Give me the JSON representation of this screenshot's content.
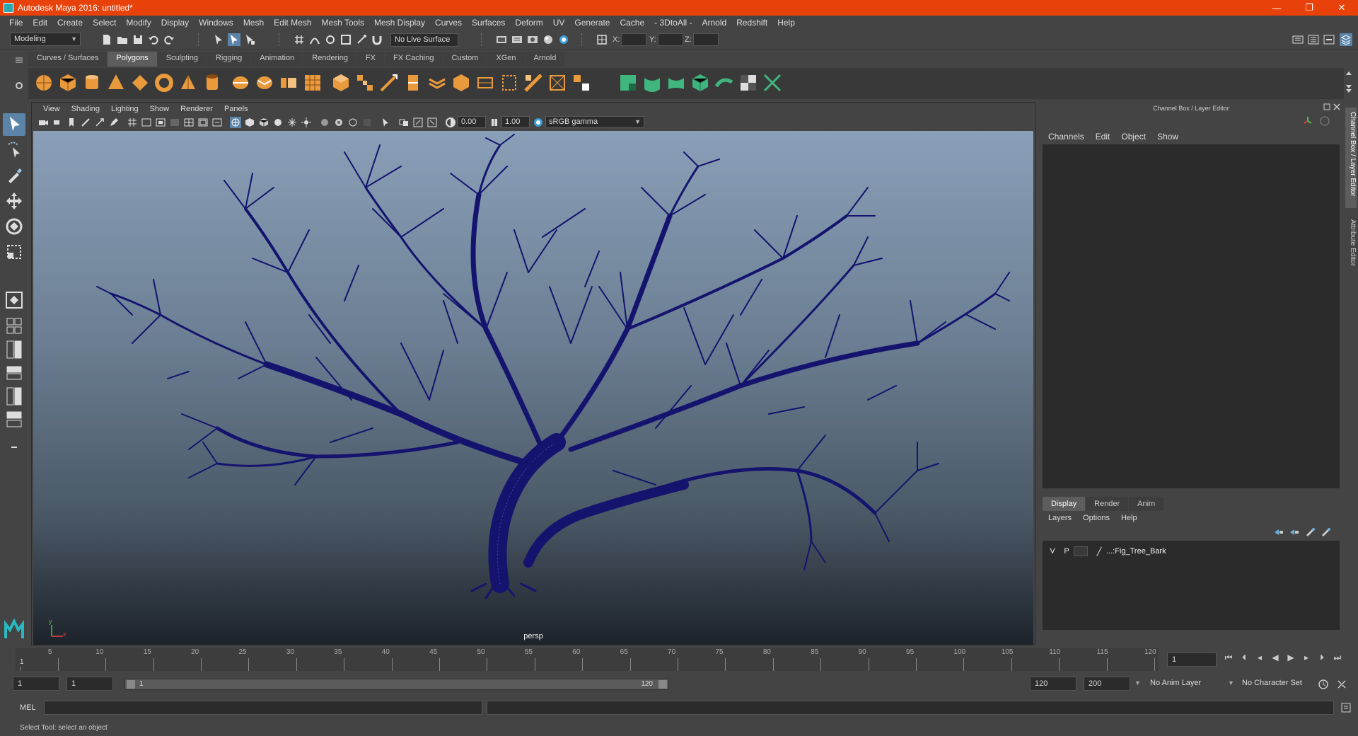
{
  "window": {
    "title": "Autodesk Maya 2016: untitled*",
    "controls": [
      "—",
      "❐",
      "✕"
    ]
  },
  "menubar": [
    "File",
    "Edit",
    "Create",
    "Select",
    "Modify",
    "Display",
    "Windows",
    "Mesh",
    "Edit Mesh",
    "Mesh Tools",
    "Mesh Display",
    "Curves",
    "Surfaces",
    "Deform",
    "UV",
    "Generate",
    "Cache",
    "- 3DtoAll -",
    "Arnold",
    "Redshift",
    "Help"
  ],
  "statusline": {
    "mode": "Modeling",
    "live_surface": "No Live Surface",
    "x_label": "X:",
    "y_label": "Y:",
    "z_label": "Z:"
  },
  "shelf_tabs": [
    {
      "label": "Curves / Surfaces",
      "active": false
    },
    {
      "label": "Polygons",
      "active": true
    },
    {
      "label": "Sculpting",
      "active": false
    },
    {
      "label": "Rigging",
      "active": false
    },
    {
      "label": "Animation",
      "active": false
    },
    {
      "label": "Rendering",
      "active": false
    },
    {
      "label": "FX",
      "active": false
    },
    {
      "label": "FX Caching",
      "active": false
    },
    {
      "label": "Custom",
      "active": false
    },
    {
      "label": "XGen",
      "active": false
    },
    {
      "label": "Arnold",
      "active": false
    }
  ],
  "viewport_panel": {
    "menu": [
      "View",
      "Shading",
      "Lighting",
      "Show",
      "Renderer",
      "Panels"
    ],
    "exposure": "0.00",
    "gamma": "1.00",
    "color_space": "sRGB gamma",
    "camera": "persp",
    "axis_x": "x",
    "axis_y": "y"
  },
  "channel_box": {
    "header": "Channel Box / Layer Editor",
    "menu": [
      "Channels",
      "Edit",
      "Object",
      "Show"
    ]
  },
  "layer_editor": {
    "tabs": [
      {
        "label": "Display",
        "active": true
      },
      {
        "label": "Render",
        "active": false
      },
      {
        "label": "Anim",
        "active": false
      }
    ],
    "menu": [
      "Layers",
      "Options",
      "Help"
    ],
    "layers": [
      {
        "visible": "V",
        "playback": "P",
        "name": "...:Fig_Tree_Bark"
      }
    ]
  },
  "side_tabs": [
    "Channel Box / Layer Editor",
    "Attribute Editor"
  ],
  "timeline": {
    "ticks": [
      5,
      10,
      15,
      20,
      25,
      30,
      35,
      40,
      45,
      50,
      55,
      60,
      65,
      70,
      75,
      80,
      85,
      90,
      95,
      100,
      105,
      110,
      115,
      120
    ],
    "start_label": "1",
    "current_frame": "1"
  },
  "range": {
    "start": "1",
    "playback_start": "1",
    "bar_start": "1",
    "bar_end": "120",
    "playback_end": "120",
    "end": "200",
    "anim_layer": "No Anim Layer",
    "character_set": "No Character Set"
  },
  "command_line": {
    "label": "MEL"
  },
  "help_line": "Select Tool: select an object",
  "colors": {
    "titlebar": "#e8420a",
    "wireframe": "#14146e",
    "accent": "#5b84a8"
  }
}
